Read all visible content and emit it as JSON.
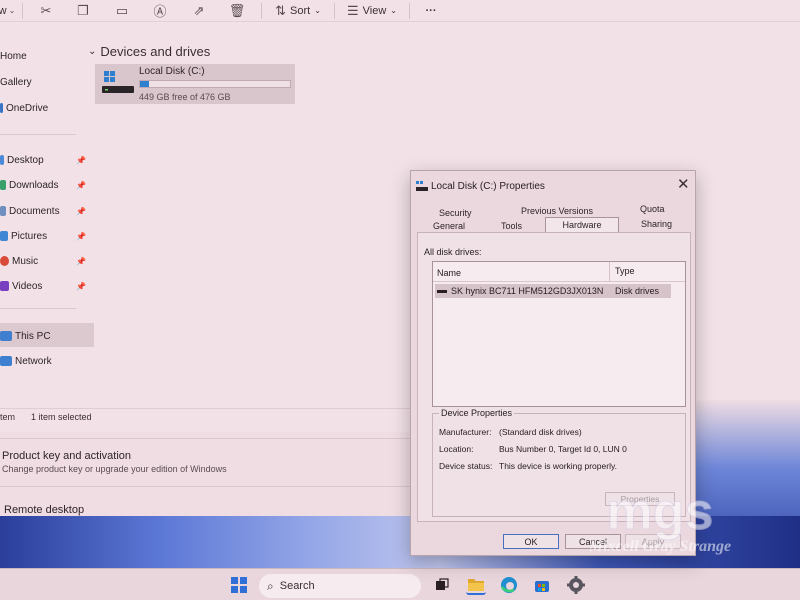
{
  "explorer": {
    "toolbar": {
      "new_partial": "w",
      "sort_label": "Sort",
      "view_label": "View",
      "more_label": "···"
    },
    "nav": {
      "home": "Home",
      "gallery": "Gallery",
      "onedrive": "OneDrive",
      "desktop": "Desktop",
      "downloads": "Downloads",
      "documents": "Documents",
      "pictures": "Pictures",
      "music": "Music",
      "videos": "Videos",
      "this_pc": "This PC",
      "network": "Network"
    },
    "section_title": "Devices and drives",
    "drive": {
      "name": "Local Disk (C:)",
      "free_text": "449 GB free of 476 GB",
      "used_fraction": 0.057
    },
    "status": {
      "items_partial": "tem",
      "selected": "1 item selected"
    }
  },
  "settings": {
    "product_key_title": "Product key and activation",
    "product_key_sub": "Change product key or upgrade your edition of Windows",
    "remote_desktop": "Remote desktop"
  },
  "dialog": {
    "title": "Local Disk (C:) Properties",
    "close": "✕",
    "tabs": {
      "security": "Security",
      "previous_versions": "Previous Versions",
      "quota": "Quota",
      "general": "General",
      "tools": "Tools",
      "hardware": "Hardware",
      "sharing": "Sharing"
    },
    "disk_list_label": "All disk drives:",
    "columns": {
      "name": "Name",
      "type": "Type"
    },
    "disk_row": {
      "name": "SK hynix BC711 HFM512GD3JX013N",
      "type": "Disk drives"
    },
    "device_properties": {
      "legend": "Device Properties",
      "manufacturer_label": "Manufacturer:",
      "manufacturer_value": "(Standard disk drives)",
      "location_label": "Location:",
      "location_value": "Bus Number 0, Target Id 0, LUN 0",
      "status_label": "Device status:",
      "status_value": "This device is working properly.",
      "properties_button": "Properties"
    },
    "buttons": {
      "ok": "OK",
      "cancel": "Cancel",
      "apply": "Apply"
    }
  },
  "taskbar": {
    "search_label": "Search"
  },
  "watermark": {
    "logo": "mgs",
    "tagline": "Mixcell Gray Strange"
  },
  "colors": {
    "accent": "#2f7fd0",
    "start_blue": "#2f6fd6",
    "background_tint": "#efdde3"
  }
}
